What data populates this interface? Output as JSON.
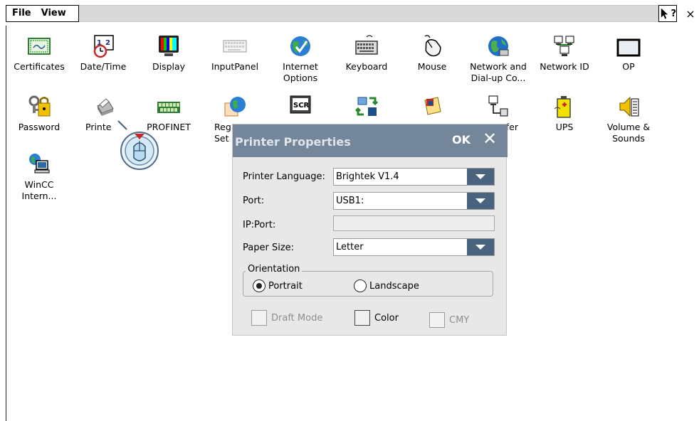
{
  "menu": {
    "file": "File",
    "view": "View",
    "help": "?",
    "close": "×"
  },
  "icons": [
    {
      "name": "Certificates",
      "label": "Certificates"
    },
    {
      "name": "Date/Time",
      "label": "Date/Time"
    },
    {
      "name": "Display",
      "label": "Display"
    },
    {
      "name": "InputPanel",
      "label": "InputPanel"
    },
    {
      "name": "Internet Options",
      "label": "Internet\nOptions"
    },
    {
      "name": "Keyboard",
      "label": "Keyboard"
    },
    {
      "name": "Mouse",
      "label": "Mouse"
    },
    {
      "name": "Network and Dial-up Co...",
      "label": "Network and\nDial-up Co..."
    },
    {
      "name": "Network ID",
      "label": "Network ID"
    },
    {
      "name": "OP",
      "label": "OP"
    },
    {
      "name": "Password",
      "label": "Password"
    },
    {
      "name": "Printer",
      "label": "Printe"
    },
    {
      "name": "PROFINET",
      "label": "PROFINET"
    },
    {
      "name": "Regional Settings",
      "label": "Reg\nSet"
    },
    {
      "name": "Screensaver",
      "label": ""
    },
    {
      "name": "Transfer1",
      "label": ""
    },
    {
      "name": "Transfer2",
      "label": ""
    },
    {
      "name": "Transfer",
      "label": "fer"
    },
    {
      "name": "UPS",
      "label": "UPS"
    },
    {
      "name": "Volume & Sounds",
      "label": "Volume &\nSounds"
    },
    {
      "name": "WinCC Internet",
      "label": "WinCC\nIntern..."
    }
  ],
  "dialog": {
    "title": "Printer Properties",
    "ok": "OK",
    "close": "✕",
    "printer_language_label": "Printer Language:",
    "printer_language_value": "Brightek V1.4",
    "port_label": "Port:",
    "port_value": "USB1:",
    "ipport_label": "IP:Port:",
    "ipport_value": "",
    "paper_size_label": "Paper Size:",
    "paper_size_value": "Letter",
    "orientation_label": "Orientation",
    "portrait_label": "Portrait",
    "landscape_label": "Landscape",
    "draft_mode_label": "Draft Mode",
    "color_label": "Color",
    "cmy_label": "CMY"
  }
}
